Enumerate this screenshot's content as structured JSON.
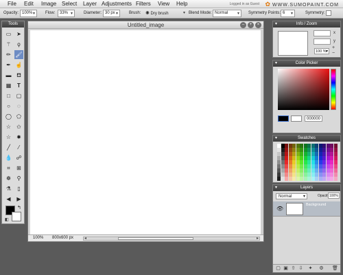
{
  "menubar": {
    "items": [
      "File",
      "Edit",
      "Image",
      "Select",
      "Layer",
      "Adjustments",
      "Filters",
      "View",
      "Help"
    ],
    "logged_in": "Logged in as Guest",
    "brand": "WWW.SUMOPAINT.COM"
  },
  "options": {
    "opacity_label": "Opacity:",
    "opacity_value": "100%",
    "flow_label": "Flow:",
    "flow_value": "33%",
    "diameter_label": "Diameter:",
    "diameter_value": "30 px",
    "brush_label": "Brush:",
    "brush_value": "Dry brush",
    "blend_label": "Blend Mode:",
    "blend_value": "Normal",
    "symmetry_points_label": "Symmetry Points:",
    "symmetry_points_value": "6",
    "symmetry_label": "Symmetry:"
  },
  "tools": {
    "title": "Tools"
  },
  "document": {
    "title": "Untitled_image",
    "zoom": "100%",
    "size": "800x600 px"
  },
  "panels": {
    "info": {
      "title": "Info / Zoom",
      "x_label": "x",
      "y_label": "y",
      "zoom_value": "100 %"
    },
    "color_picker": {
      "title": "Color Picker",
      "hex": "000000"
    },
    "swatches": {
      "title": "Swatches"
    },
    "layers": {
      "title": "Layers",
      "blend": "Normal",
      "opacity_label": "Opacity:",
      "opacity_value": "100%",
      "layer_name": "Background"
    }
  }
}
